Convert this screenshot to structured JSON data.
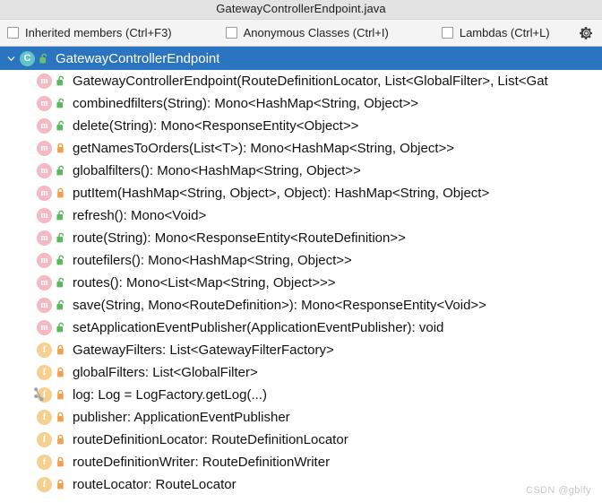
{
  "window": {
    "title": "GatewayControllerEndpoint.java"
  },
  "toolbar": {
    "checkboxes": [
      {
        "label": "Inherited members (Ctrl+F3)",
        "checked": false
      },
      {
        "label": "Anonymous Classes (Ctrl+I)",
        "checked": false
      },
      {
        "label": "Lambdas (Ctrl+L)",
        "checked": false
      }
    ],
    "settings_icon": "gear-icon"
  },
  "tree": {
    "root": {
      "label": "GatewayControllerEndpoint",
      "icon": "class-icon",
      "visibility": "public",
      "expanded": true,
      "selected": true,
      "chevron": "chevron-down-icon"
    },
    "members": [
      {
        "label": "GatewayControllerEndpoint(RouteDefinitionLocator, List<GlobalFilter>, List<Gat",
        "kind": "method",
        "visibility": "public",
        "static": false
      },
      {
        "label": "combinedfilters(String): Mono<HashMap<String, Object>>",
        "kind": "method",
        "visibility": "public",
        "static": false
      },
      {
        "label": "delete(String): Mono<ResponseEntity<Object>>",
        "kind": "method",
        "visibility": "public",
        "static": false
      },
      {
        "label": "getNamesToOrders(List<T>): Mono<HashMap<String, Object>>",
        "kind": "method",
        "visibility": "private",
        "static": false
      },
      {
        "label": "globalfilters(): Mono<HashMap<String, Object>>",
        "kind": "method",
        "visibility": "public",
        "static": false
      },
      {
        "label": "putItem(HashMap<String, Object>, Object): HashMap<String, Object>",
        "kind": "method",
        "visibility": "private",
        "static": false
      },
      {
        "label": "refresh(): Mono<Void>",
        "kind": "method",
        "visibility": "public",
        "static": false
      },
      {
        "label": "route(String): Mono<ResponseEntity<RouteDefinition>>",
        "kind": "method",
        "visibility": "public",
        "static": false
      },
      {
        "label": "routefilers(): Mono<HashMap<String, Object>>",
        "kind": "method",
        "visibility": "public",
        "static": false
      },
      {
        "label": "routes(): Mono<List<Map<String, Object>>>",
        "kind": "method",
        "visibility": "public",
        "static": false
      },
      {
        "label": "save(String, Mono<RouteDefinition>): Mono<ResponseEntity<Void>>",
        "kind": "method",
        "visibility": "public",
        "static": false
      },
      {
        "label": "setApplicationEventPublisher(ApplicationEventPublisher): void",
        "kind": "method",
        "visibility": "public",
        "static": false
      },
      {
        "label": "GatewayFilters: List<GatewayFilterFactory>",
        "kind": "field",
        "visibility": "private",
        "static": false
      },
      {
        "label": "globalFilters: List<GlobalFilter>",
        "kind": "field",
        "visibility": "private",
        "static": false
      },
      {
        "label": "log: Log = LogFactory.getLog(...)",
        "kind": "field",
        "visibility": "private",
        "static": true
      },
      {
        "label": "publisher: ApplicationEventPublisher",
        "kind": "field",
        "visibility": "private",
        "static": false
      },
      {
        "label": "routeDefinitionLocator: RouteDefinitionLocator",
        "kind": "field",
        "visibility": "private",
        "static": false
      },
      {
        "label": "routeDefinitionWriter: RouteDefinitionWriter",
        "kind": "field",
        "visibility": "private",
        "static": false
      },
      {
        "label": "routeLocator: RouteLocator",
        "kind": "field",
        "visibility": "private",
        "static": false
      }
    ]
  },
  "watermark": {
    "text": "CSDN @gblfy"
  },
  "colors": {
    "selection_blue": "#2a74c0",
    "method_pink": "#f4b9c4",
    "field_orange": "#f6d091",
    "class_teal": "#62c4c9",
    "lock_public_green": "#5eb85e",
    "lock_private_orange": "#f0a050"
  }
}
